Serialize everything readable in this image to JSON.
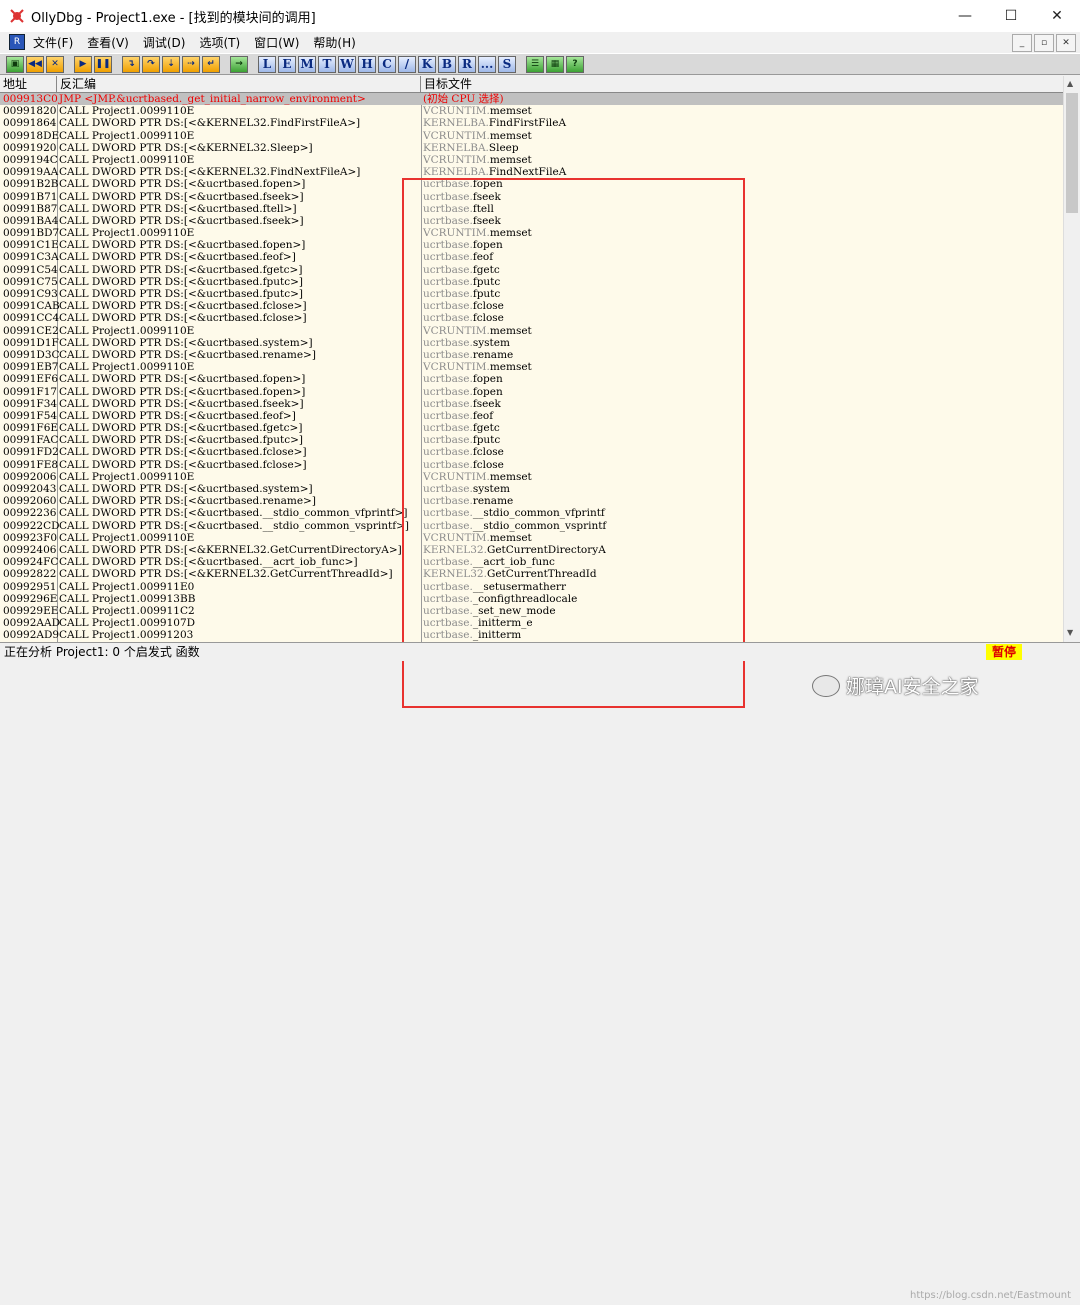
{
  "window": {
    "title": "OllyDbg - Project1.exe - [找到的模块间的调用]",
    "buttons": {
      "minimize": "—",
      "maximize": "☐",
      "close": "✕"
    }
  },
  "menu": {
    "app_icon": "R",
    "items": [
      "文件(F)",
      "查看(V)",
      "调试(D)",
      "选项(T)",
      "窗口(W)",
      "帮助(H)"
    ],
    "mdi": {
      "minimize": "_",
      "restore": "▫",
      "close": "✕"
    }
  },
  "toolbar": {
    "letters": [
      "L",
      "E",
      "M",
      "T",
      "W",
      "H",
      "C",
      "/",
      "K",
      "B",
      "R",
      "...",
      "S"
    ]
  },
  "columns": {
    "address": "地址",
    "disassembly": "反汇编",
    "target": "目标文件"
  },
  "rows": [
    {
      "addr": "009913C0",
      "dis": "JMP <JMP.&ucrtbased._get_initial_narrow_environment>",
      "mod": "(初始 CPU 选择)",
      "fn": ""
    },
    {
      "addr": "00991820",
      "dis": "CALL Project1.0099110E",
      "mod": "VCRUNTIM.",
      "fn": "memset"
    },
    {
      "addr": "00991864",
      "dis": "CALL DWORD PTR DS:[<&KERNEL32.FindFirstFileA>]",
      "mod": "KERNELBA.",
      "fn": "FindFirstFileA"
    },
    {
      "addr": "009918DE",
      "dis": "CALL Project1.0099110E",
      "mod": "VCRUNTIM.",
      "fn": "memset"
    },
    {
      "addr": "00991920",
      "dis": "CALL DWORD PTR DS:[<&KERNEL32.Sleep>]",
      "mod": "KERNELBA.",
      "fn": "Sleep"
    },
    {
      "addr": "0099194C",
      "dis": "CALL Project1.0099110E",
      "mod": "VCRUNTIM.",
      "fn": "memset"
    },
    {
      "addr": "009919AA",
      "dis": "CALL DWORD PTR DS:[<&KERNEL32.FindNextFileA>]",
      "mod": "KERNELBA.",
      "fn": "FindNextFileA"
    },
    {
      "addr": "00991B2B",
      "dis": "CALL DWORD PTR DS:[<&ucrtbased.fopen>]",
      "mod": "ucrtbase.",
      "fn": "fopen"
    },
    {
      "addr": "00991B71",
      "dis": "CALL DWORD PTR DS:[<&ucrtbased.fseek>]",
      "mod": "ucrtbase.",
      "fn": "fseek"
    },
    {
      "addr": "00991B87",
      "dis": "CALL DWORD PTR DS:[<&ucrtbased.ftell>]",
      "mod": "ucrtbase.",
      "fn": "ftell"
    },
    {
      "addr": "00991BA4",
      "dis": "CALL DWORD PTR DS:[<&ucrtbased.fseek>]",
      "mod": "ucrtbase.",
      "fn": "fseek"
    },
    {
      "addr": "00991BD7",
      "dis": "CALL Project1.0099110E",
      "mod": "VCRUNTIM.",
      "fn": "memset"
    },
    {
      "addr": "00991C1E",
      "dis": "CALL DWORD PTR DS:[<&ucrtbased.fopen>]",
      "mod": "ucrtbase.",
      "fn": "fopen"
    },
    {
      "addr": "00991C3A",
      "dis": "CALL DWORD PTR DS:[<&ucrtbased.feof>]",
      "mod": "ucrtbase.",
      "fn": "feof"
    },
    {
      "addr": "00991C54",
      "dis": "CALL DWORD PTR DS:[<&ucrtbased.fgetc>]",
      "mod": "ucrtbase.",
      "fn": "fgetc"
    },
    {
      "addr": "00991C75",
      "dis": "CALL DWORD PTR DS:[<&ucrtbased.fputc>]",
      "mod": "ucrtbase.",
      "fn": "fputc"
    },
    {
      "addr": "00991C93",
      "dis": "CALL DWORD PTR DS:[<&ucrtbased.fputc>]",
      "mod": "ucrtbase.",
      "fn": "fputc"
    },
    {
      "addr": "00991CAB",
      "dis": "CALL DWORD PTR DS:[<&ucrtbased.fclose>]",
      "mod": "ucrtbase.",
      "fn": "fclose"
    },
    {
      "addr": "00991CC4",
      "dis": "CALL DWORD PTR DS:[<&ucrtbased.fclose>]",
      "mod": "ucrtbase.",
      "fn": "fclose"
    },
    {
      "addr": "00991CE2",
      "dis": "CALL Project1.0099110E",
      "mod": "VCRUNTIM.",
      "fn": "memset"
    },
    {
      "addr": "00991D1F",
      "dis": "CALL DWORD PTR DS:[<&ucrtbased.system>]",
      "mod": "ucrtbase.",
      "fn": "system"
    },
    {
      "addr": "00991D3C",
      "dis": "CALL DWORD PTR DS:[<&ucrtbased.rename>]",
      "mod": "ucrtbase.",
      "fn": "rename"
    },
    {
      "addr": "00991EB7",
      "dis": "CALL Project1.0099110E",
      "mod": "VCRUNTIM.",
      "fn": "memset"
    },
    {
      "addr": "00991EF6",
      "dis": "CALL DWORD PTR DS:[<&ucrtbased.fopen>]",
      "mod": "ucrtbase.",
      "fn": "fopen"
    },
    {
      "addr": "00991F17",
      "dis": "CALL DWORD PTR DS:[<&ucrtbased.fopen>]",
      "mod": "ucrtbase.",
      "fn": "fopen"
    },
    {
      "addr": "00991F34",
      "dis": "CALL DWORD PTR DS:[<&ucrtbased.fseek>]",
      "mod": "ucrtbase.",
      "fn": "fseek"
    },
    {
      "addr": "00991F54",
      "dis": "CALL DWORD PTR DS:[<&ucrtbased.feof>]",
      "mod": "ucrtbase.",
      "fn": "feof"
    },
    {
      "addr": "00991F6E",
      "dis": "CALL DWORD PTR DS:[<&ucrtbased.fgetc>]",
      "mod": "ucrtbase.",
      "fn": "fgetc"
    },
    {
      "addr": "00991FAC",
      "dis": "CALL DWORD PTR DS:[<&ucrtbased.fputc>]",
      "mod": "ucrtbase.",
      "fn": "fputc"
    },
    {
      "addr": "00991FD2",
      "dis": "CALL DWORD PTR DS:[<&ucrtbased.fclose>]",
      "mod": "ucrtbase.",
      "fn": "fclose"
    },
    {
      "addr": "00991FE8",
      "dis": "CALL DWORD PTR DS:[<&ucrtbased.fclose>]",
      "mod": "ucrtbase.",
      "fn": "fclose"
    },
    {
      "addr": "00992006",
      "dis": "CALL Project1.0099110E",
      "mod": "VCRUNTIM.",
      "fn": "memset"
    },
    {
      "addr": "00992043",
      "dis": "CALL DWORD PTR DS:[<&ucrtbased.system>]",
      "mod": "ucrtbase.",
      "fn": "system"
    },
    {
      "addr": "00992060",
      "dis": "CALL DWORD PTR DS:[<&ucrtbased.rename>]",
      "mod": "ucrtbase.",
      "fn": "rename"
    },
    {
      "addr": "00992236",
      "dis": "CALL DWORD PTR DS:[<&ucrtbased.__stdio_common_vfprintf>]",
      "mod": "ucrtbase.",
      "fn": "__stdio_common_vfprintf"
    },
    {
      "addr": "009922CD",
      "dis": "CALL DWORD PTR DS:[<&ucrtbased.__stdio_common_vsprintf>]",
      "mod": "ucrtbase.",
      "fn": "__stdio_common_vsprintf"
    },
    {
      "addr": "009923F0",
      "dis": "CALL Project1.0099110E",
      "mod": "VCRUNTIM.",
      "fn": "memset"
    },
    {
      "addr": "00992406",
      "dis": "CALL DWORD PTR DS:[<&KERNEL32.GetCurrentDirectoryA>]",
      "mod": "KERNEL32.",
      "fn": "GetCurrentDirectoryA"
    },
    {
      "addr": "009924FC",
      "dis": "CALL DWORD PTR DS:[<&ucrtbased.__acrt_iob_func>]",
      "mod": "ucrtbase.",
      "fn": "__acrt_iob_func"
    },
    {
      "addr": "00992822",
      "dis": "CALL DWORD PTR DS:[<&KERNEL32.GetCurrentThreadId>]",
      "mod": "KERNEL32.",
      "fn": "GetCurrentThreadId"
    },
    {
      "addr": "00992951",
      "dis": "CALL Project1.009911E0",
      "mod": "ucrtbase.",
      "fn": "__setusermatherr"
    },
    {
      "addr": "0099296E",
      "dis": "CALL Project1.009913BB",
      "mod": "ucrtbase.",
      "fn": "_configthreadlocale"
    },
    {
      "addr": "009929EE",
      "dis": "CALL Project1.009911C2",
      "mod": "ucrtbase.",
      "fn": "_set_new_mode"
    },
    {
      "addr": "00992AAD",
      "dis": "CALL Project1.0099107D",
      "mod": "ucrtbase.",
      "fn": "_initterm_e"
    },
    {
      "addr": "00992AD9",
      "dis": "CALL Project1.00991203",
      "mod": "ucrtbase.",
      "fn": "_initterm"
    }
  ],
  "status": {
    "text": "正在分析 Project1: 0 个启发式 函数",
    "paused": "暂停"
  },
  "watermark": "娜璋AI安全之家",
  "csdn": "https://blog.csdn.net/Eastmount",
  "colors": {
    "selected_text": "#ee0000",
    "highlight_box": "#e8322f",
    "row_bg": "#fefaea"
  }
}
